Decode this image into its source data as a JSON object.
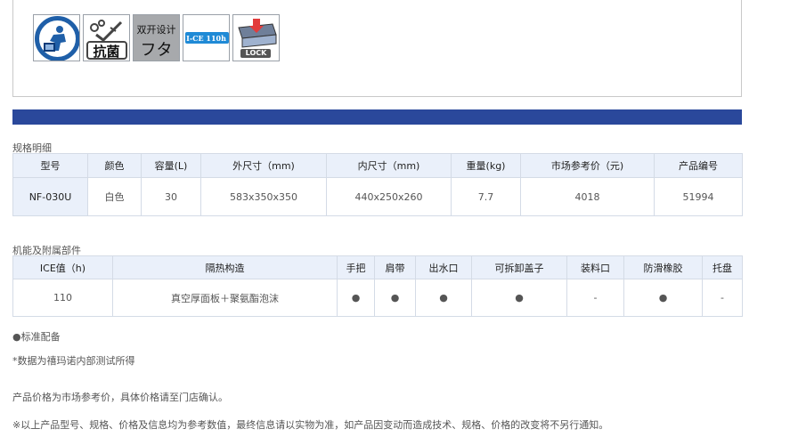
{
  "features": [
    {
      "icon": "inner-chamber-icon",
      "caption": ""
    },
    {
      "icon": "antibacterial-icon",
      "caption": "抗菌"
    },
    {
      "icon": "double-lid-icon",
      "caption_top": "双开设计",
      "caption": "フタ"
    },
    {
      "icon": "ice-hours-icon",
      "caption": "I-CE 110h"
    },
    {
      "icon": "lock-icon",
      "caption": "LOCK"
    }
  ],
  "spec": {
    "title": "规格明细",
    "headers": [
      "型号",
      "颜色",
      "容量(L)",
      "外尺寸（mm)",
      "内尺寸（mm)",
      "重量(kg)",
      "市场参考价（元)",
      "产品编号"
    ],
    "rows": [
      [
        "NF-030U",
        "白色",
        "30",
        "583x350x350",
        "440x250x260",
        "7.7",
        "4018",
        "51994"
      ]
    ]
  },
  "functions": {
    "title": "机能及附属部件",
    "headers": [
      "ICE值（h)",
      "隔热构造",
      "手把",
      "肩带",
      "出水口",
      "可拆卸盖子",
      "装料口",
      "防滑橡胶",
      "托盘"
    ],
    "rows": [
      [
        "110",
        "真空厚面板＋聚氨酯泡沫",
        "●",
        "●",
        "●",
        "●",
        "-",
        "●",
        "-"
      ]
    ]
  },
  "notes": {
    "legend": "●标准配备",
    "test": "*数据为禧玛诺内部测试所得",
    "price": "产品价格为市场参考价，具体价格请至门店确认。",
    "disclaimer": "※以上产品型号、规格、价格及信息均为参考数值，最终信息请以实物为准，如产品因变动而造成技术、规格、价格的改变将不另行通知。"
  },
  "colors": {
    "bar": "#2a489b",
    "header_bg": "#eaf0fa",
    "border": "#d4dbe6",
    "icon_blue": "#1f5fa8"
  }
}
